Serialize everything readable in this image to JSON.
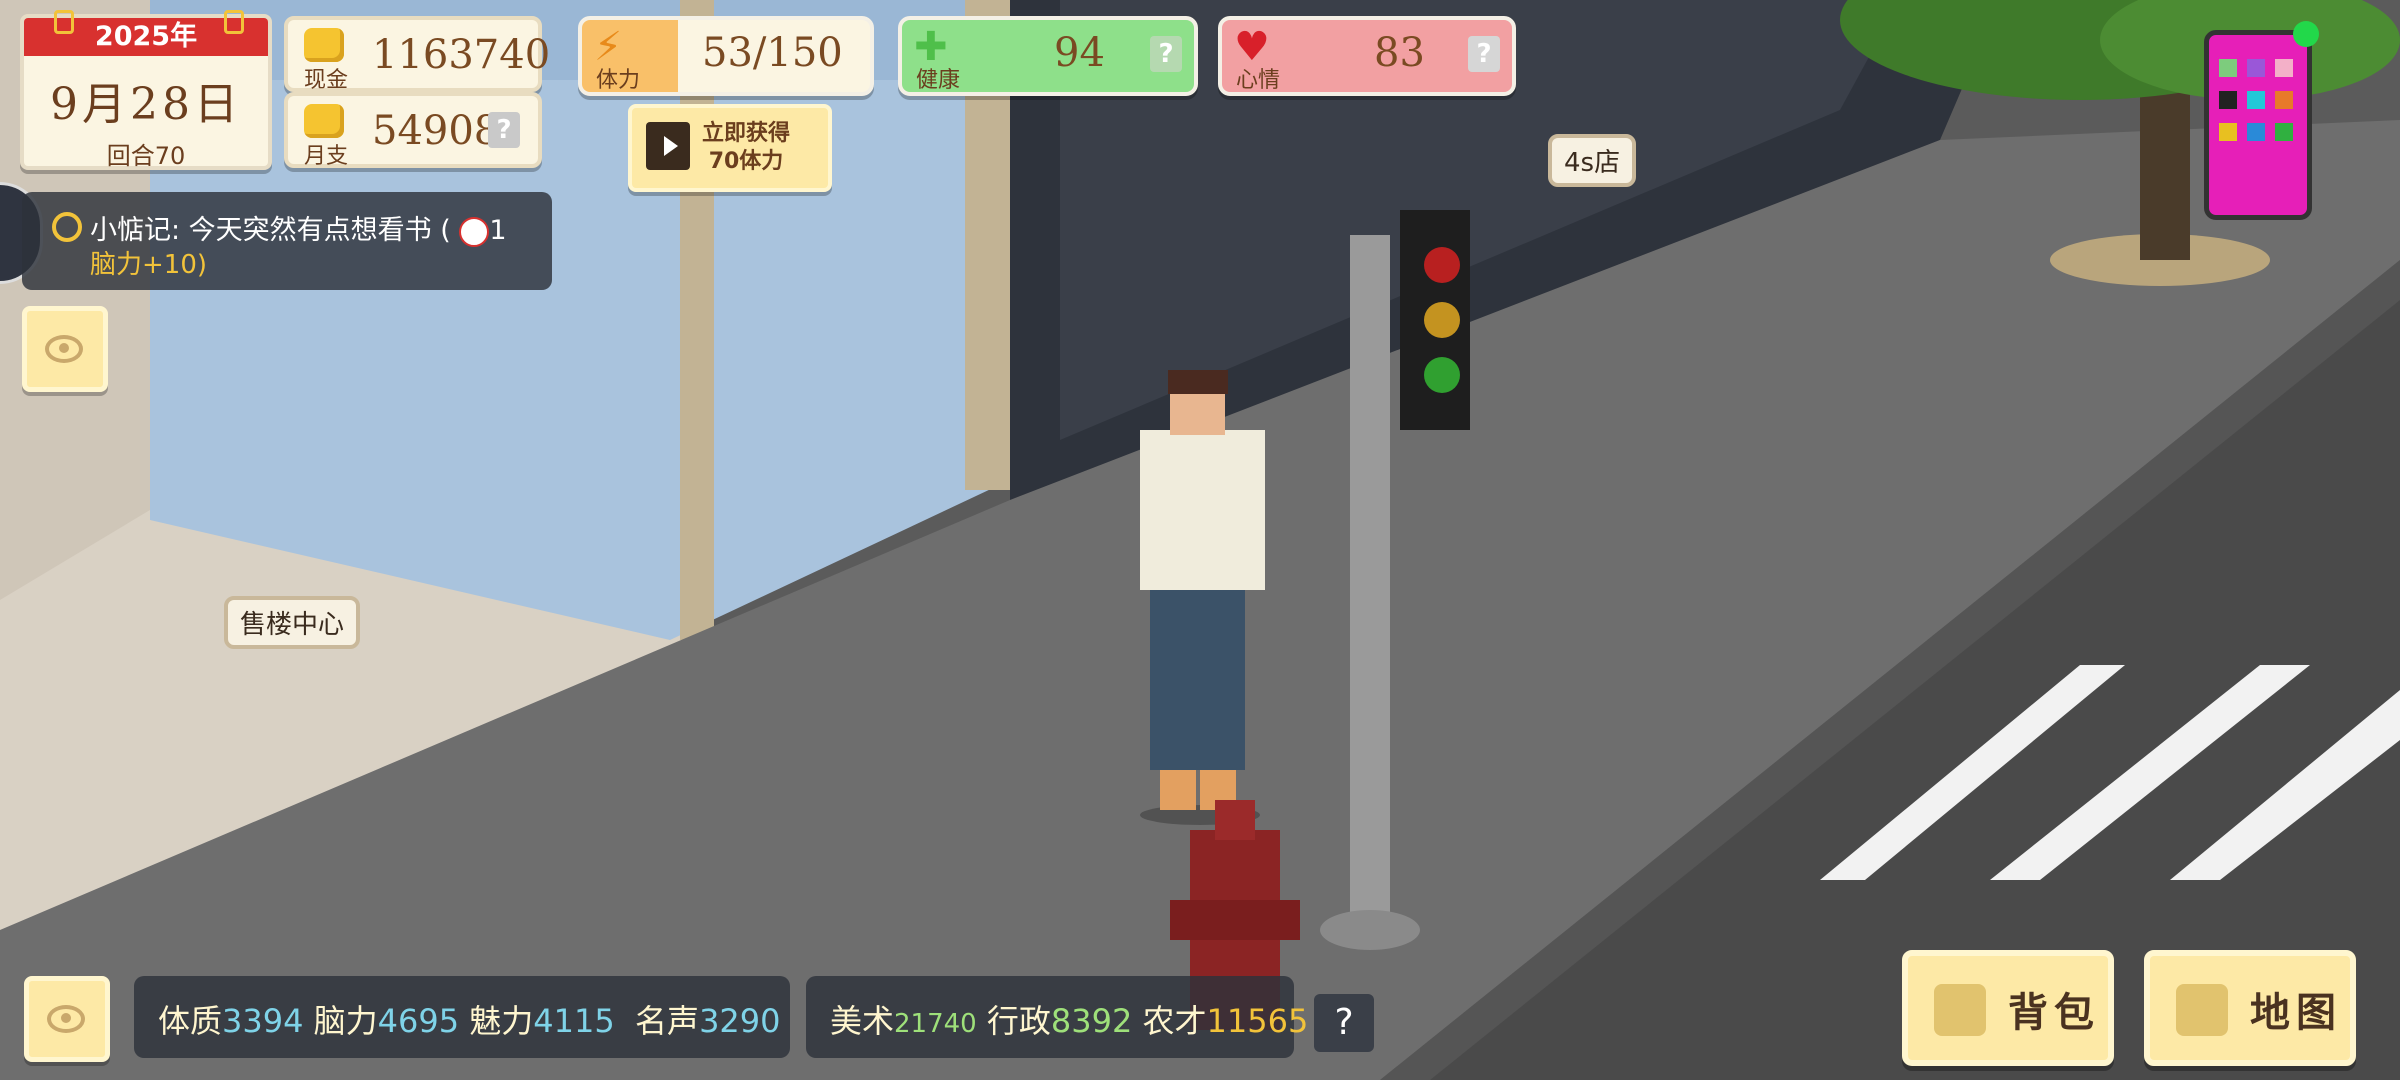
{
  "calendar": {
    "year": "2025年",
    "date": "9月28日",
    "round": "回合70"
  },
  "money": {
    "cash_label": "现金",
    "cash_value": "1163740",
    "monthly_label": "月支",
    "monthly_value": "54908",
    "help": "?"
  },
  "stats": {
    "stamina": {
      "label": "体力",
      "value": "53/150"
    },
    "health": {
      "label": "健康",
      "value": "94",
      "help": "?"
    },
    "mood": {
      "label": "心情",
      "value": "83",
      "help": "?"
    }
  },
  "get_stamina": {
    "line1": "立即获得",
    "line2": "70体力"
  },
  "note": {
    "text_line1": "小惦记: 今天突然有点想看书 (",
    "text_suffix": "1",
    "text_line2": "脑力+10)"
  },
  "locations": {
    "car_shop": "4s店",
    "sales_center": "售楼中心"
  },
  "attributes": [
    {
      "label": "体质",
      "value": "3394"
    },
    {
      "label": "脑力",
      "value": "4695"
    },
    {
      "label": "魅力",
      "value": "4115"
    },
    {
      "label": "名声",
      "value": "3290"
    }
  ],
  "skills": [
    {
      "label": "美术",
      "value": "21740"
    },
    {
      "label": "行政",
      "value": "8392"
    },
    {
      "label": "农才",
      "value": "11565"
    }
  ],
  "skills_help": "?",
  "buttons": {
    "backpack": "背包",
    "map": "地图"
  },
  "colors": {
    "cash_coin": "#f5c430",
    "health_bg": "#8ee08a",
    "mood_bg": "#f2a0a2",
    "stamina_icon": "#f9c069",
    "accent_yellow": "#fde9a6"
  }
}
